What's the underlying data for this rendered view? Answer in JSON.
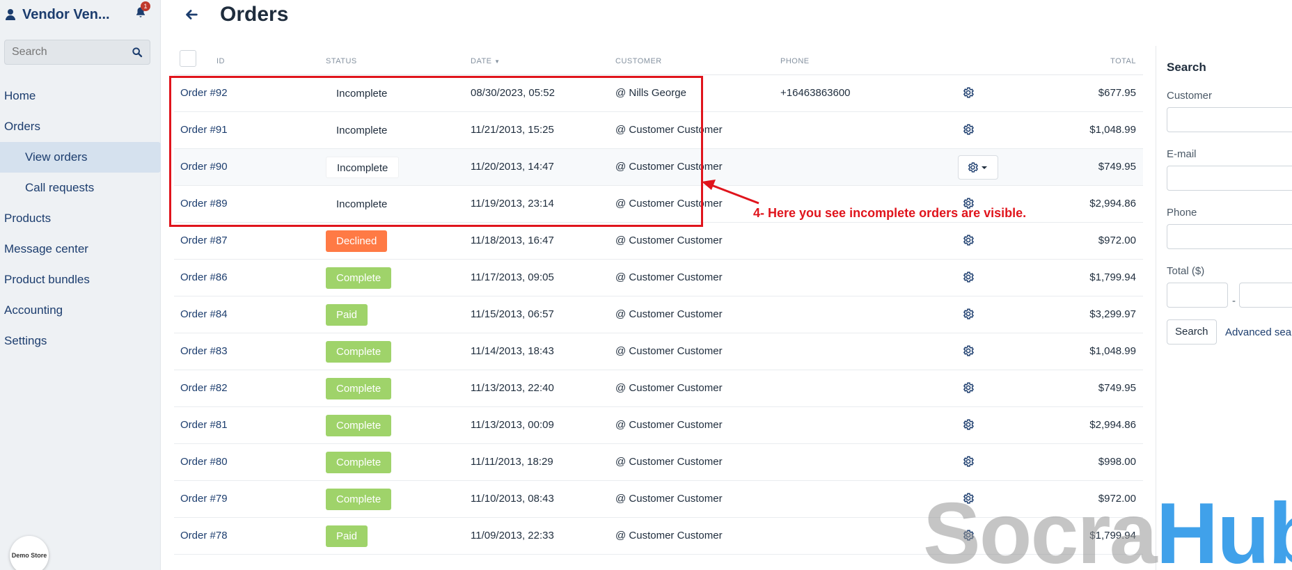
{
  "sidebar": {
    "brand": "Vendor Ven...",
    "notification_count": "1",
    "search_placeholder": "Search",
    "nav": [
      {
        "label": "Home"
      },
      {
        "label": "Orders"
      },
      {
        "label": "View orders",
        "active": true
      },
      {
        "label": "Call requests"
      },
      {
        "label": "Products"
      },
      {
        "label": "Message center"
      },
      {
        "label": "Product bundles"
      },
      {
        "label": "Accounting"
      },
      {
        "label": "Settings"
      }
    ],
    "demo_badge": "Demo Store"
  },
  "header": {
    "title": "Orders"
  },
  "table": {
    "columns": {
      "id": "ID",
      "status": "STATUS",
      "date": "DATE",
      "customer": "CUSTOMER",
      "phone": "PHONE",
      "total": "TOTAL"
    },
    "rows": [
      {
        "id": "Order #92",
        "status": "Incomplete",
        "status_type": "incomplete",
        "date": "08/30/2023, 05:52",
        "customer": "@ Nills George",
        "phone": "+16463863600",
        "total": "$677.95"
      },
      {
        "id": "Order #91",
        "status": "Incomplete",
        "status_type": "incomplete",
        "date": "11/21/2013, 15:25",
        "customer": "@ Customer Customer",
        "phone": "",
        "total": "$1,048.99"
      },
      {
        "id": "Order #90",
        "status": "Incomplete",
        "status_type": "incomplete",
        "date": "11/20/2013, 14:47",
        "customer": "@ Customer Customer",
        "phone": "",
        "total": "$749.95"
      },
      {
        "id": "Order #89",
        "status": "Incomplete",
        "status_type": "incomplete",
        "date": "11/19/2013, 23:14",
        "customer": "@ Customer Customer",
        "phone": "",
        "total": "$2,994.86"
      },
      {
        "id": "Order #87",
        "status": "Declined",
        "status_type": "declined",
        "date": "11/18/2013, 16:47",
        "customer": "@ Customer Customer",
        "phone": "",
        "total": "$972.00"
      },
      {
        "id": "Order #86",
        "status": "Complete",
        "status_type": "complete",
        "date": "11/17/2013, 09:05",
        "customer": "@ Customer Customer",
        "phone": "",
        "total": "$1,799.94"
      },
      {
        "id": "Order #84",
        "status": "Paid",
        "status_type": "paid",
        "date": "11/15/2013, 06:57",
        "customer": "@ Customer Customer",
        "phone": "",
        "total": "$3,299.97"
      },
      {
        "id": "Order #83",
        "status": "Complete",
        "status_type": "complete",
        "date": "11/14/2013, 18:43",
        "customer": "@ Customer Customer",
        "phone": "",
        "total": "$1,048.99"
      },
      {
        "id": "Order #82",
        "status": "Complete",
        "status_type": "complete",
        "date": "11/13/2013, 22:40",
        "customer": "@ Customer Customer",
        "phone": "",
        "total": "$749.95"
      },
      {
        "id": "Order #81",
        "status": "Complete",
        "status_type": "complete",
        "date": "11/13/2013, 00:09",
        "customer": "@ Customer Customer",
        "phone": "",
        "total": "$2,994.86"
      },
      {
        "id": "Order #80",
        "status": "Complete",
        "status_type": "complete",
        "date": "11/11/2013, 18:29",
        "customer": "@ Customer Customer",
        "phone": "",
        "total": "$998.00"
      },
      {
        "id": "Order #79",
        "status": "Complete",
        "status_type": "complete",
        "date": "11/10/2013, 08:43",
        "customer": "@ Customer Customer",
        "phone": "",
        "total": "$972.00"
      },
      {
        "id": "Order #78",
        "status": "Paid",
        "status_type": "paid",
        "date": "11/09/2013, 22:33",
        "customer": "@ Customer Customer",
        "phone": "",
        "total": "$1,799.94"
      }
    ]
  },
  "search_panel": {
    "title": "Search",
    "customer_label": "Customer",
    "email_label": "E-mail",
    "phone_label": "Phone",
    "total_label": "Total ($)",
    "range_dash": "-",
    "search_button": "Search",
    "advanced_link": "Advanced sea"
  },
  "annotation": {
    "text": "4- Here you see incomplete orders are visible.",
    "color": "#e0141c"
  },
  "watermark": {
    "part1": "Socra",
    "part2": "Hub"
  },
  "colors": {
    "brand": "#1c3d6e",
    "complete": "#9fd36a",
    "paid": "#9fd36a",
    "declined": "#ff7a45",
    "badge": "#c0392b"
  }
}
